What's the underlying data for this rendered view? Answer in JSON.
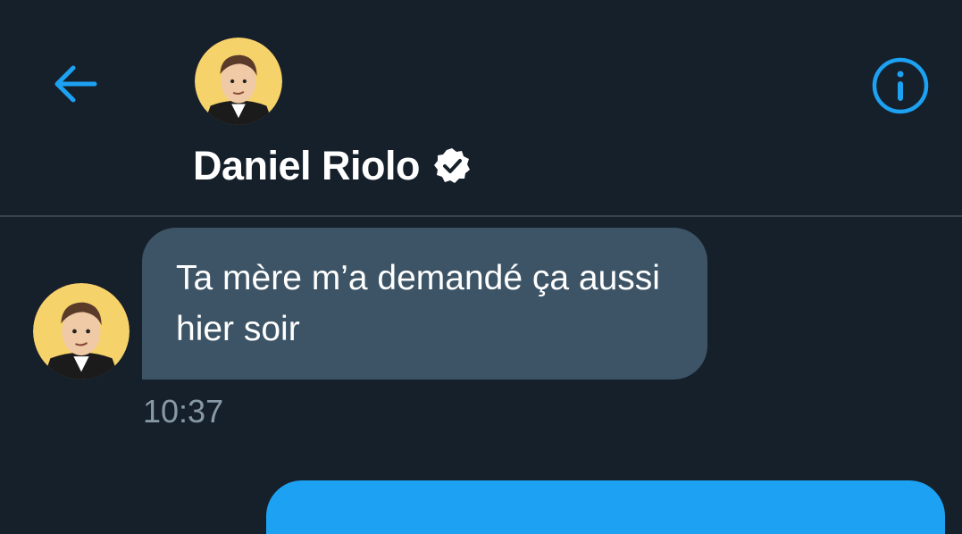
{
  "header": {
    "title": "Daniel Riolo",
    "verified": true,
    "back_icon": "arrow-left-icon",
    "info_icon": "info-icon"
  },
  "messages": [
    {
      "direction": "incoming",
      "text": "Ta mère m’a demandé ça aussi hier soir",
      "time": "10:37"
    }
  ],
  "colors": {
    "background": "#15202b",
    "accent": "#1da1f2",
    "incoming_bubble": "#3d5466",
    "divider": "#38444d",
    "timestamp": "#8899a6"
  }
}
